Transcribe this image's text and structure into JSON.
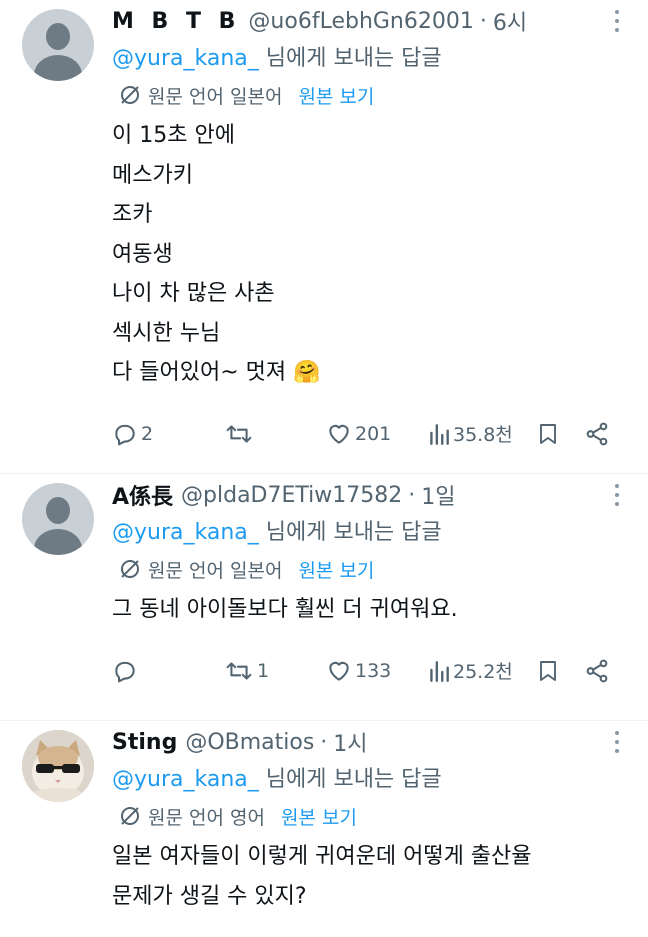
{
  "tweets": [
    {
      "name": "M B T B",
      "handle": "@uo6fLebhGn62001",
      "separator": "·",
      "time": "6시",
      "reply_mention": "@yura_kana_",
      "reply_suffix": " 님에게 보내는 답글",
      "translate_label": "원문 언어 일본어",
      "show_original": "원본 보기",
      "text": "이 15초 안에\n메스가키\n조카\n여동생\n나이 차 많은 사촌\n섹시한 누님\n다 들어있어~ 멋져 🤗",
      "replies": "2",
      "retweets": "",
      "likes": "201",
      "views": "35.8천",
      "avatar_icon": "default-avatar"
    },
    {
      "name": "A係長",
      "handle": "@pldaD7ETiw17582",
      "separator": "·",
      "time": "1일",
      "reply_mention": "@yura_kana_",
      "reply_suffix": " 님에게 보내는 답글",
      "translate_label": "원문 언어 일본어",
      "show_original": "원본 보기",
      "text": "그 동네 아이돌보다 훨씬 더 귀여워요.",
      "replies": "",
      "retweets": "1",
      "likes": "133",
      "views": "25.2천",
      "avatar_icon": "default-avatar"
    },
    {
      "name": "Sting",
      "handle": "@OBmatios",
      "separator": "·",
      "time": "1시",
      "reply_mention": "@yura_kana_",
      "reply_suffix": " 님에게 보내는 답글",
      "translate_label": "원문 언어 영어",
      "show_original": "원본 보기",
      "text": "일본 여자들이 이렇게 귀여운데 어떻게 출산율\n문제가 생길 수 있지?",
      "avatar_icon": "cat-sunglasses-avatar"
    }
  ],
  "colors": {
    "link": "#1d9bf0",
    "secondary": "#536471",
    "primary_text": "#0f1419",
    "divider": "#eff3f4"
  }
}
